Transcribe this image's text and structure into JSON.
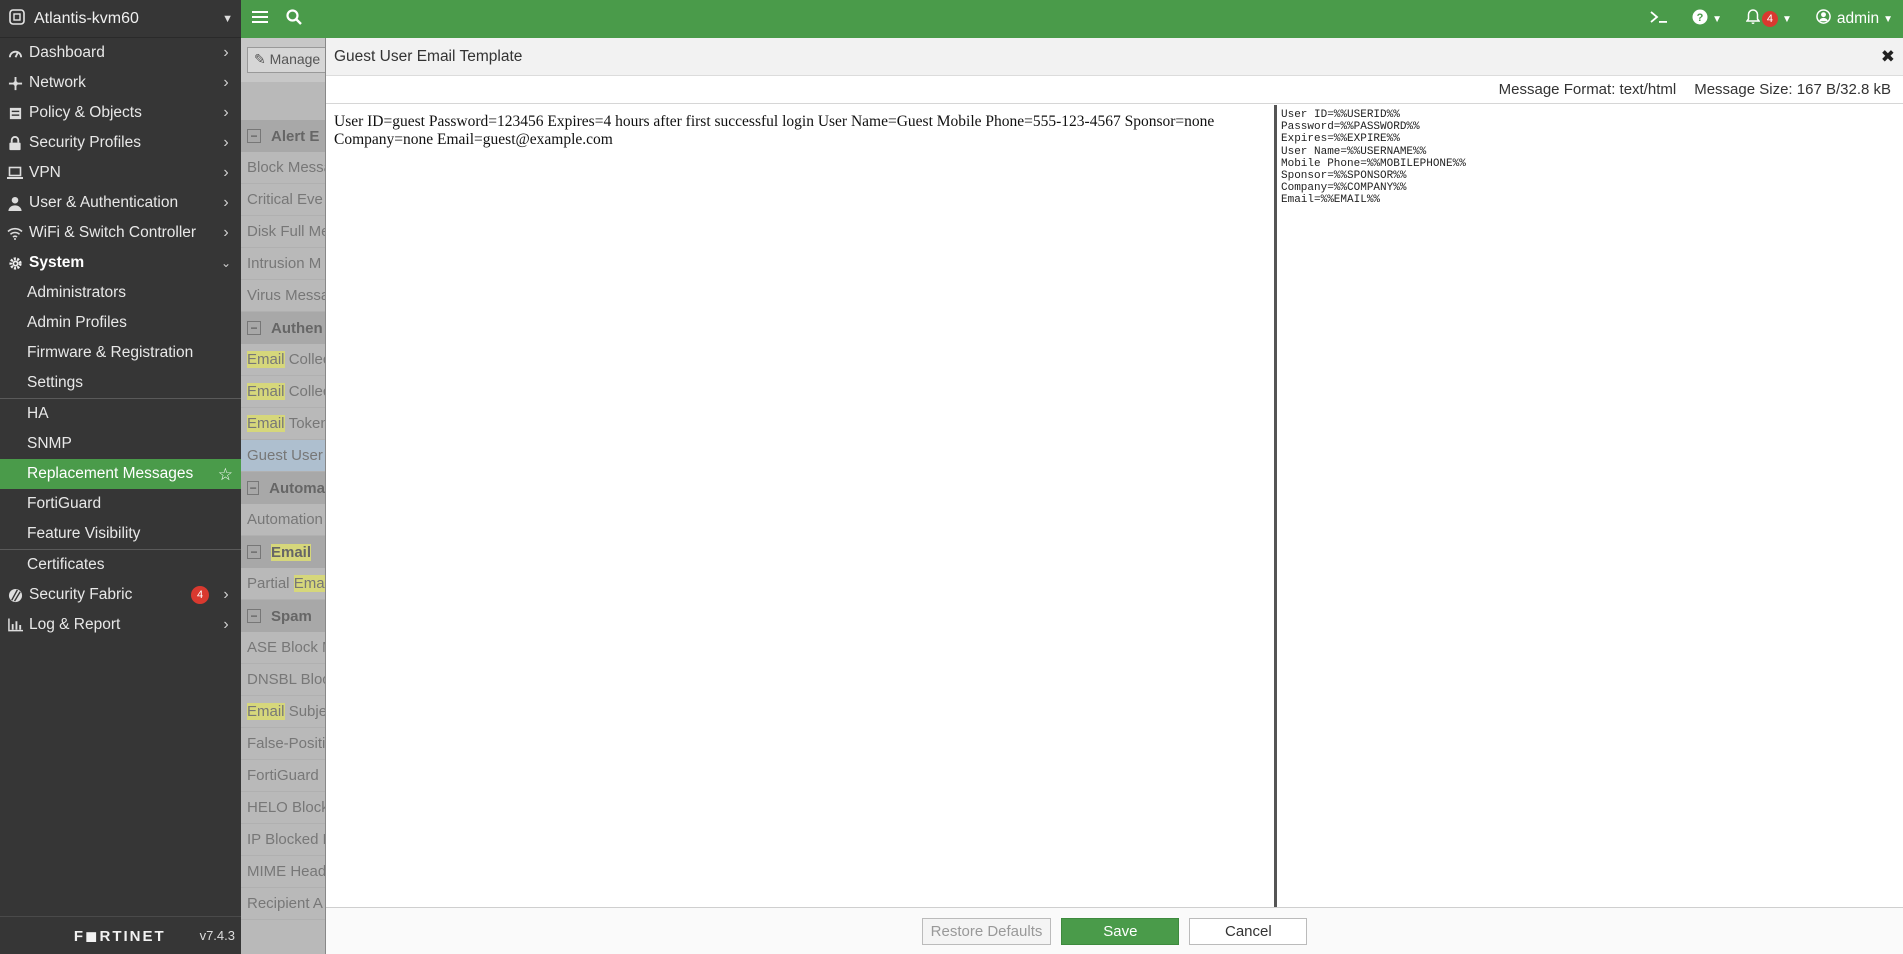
{
  "sidebar": {
    "hostname": "Atlantis-kvm60",
    "items": [
      {
        "label": "Dashboard",
        "icon": "dashboard-icon"
      },
      {
        "label": "Network",
        "icon": "network-icon"
      },
      {
        "label": "Policy & Objects",
        "icon": "policy-icon"
      },
      {
        "label": "Security Profiles",
        "icon": "lock-icon"
      },
      {
        "label": "VPN",
        "icon": "laptop-icon"
      },
      {
        "label": "User & Authentication",
        "icon": "user-icon"
      },
      {
        "label": "WiFi & Switch Controller",
        "icon": "wifi-icon"
      },
      {
        "label": "System",
        "icon": "gear-icon"
      }
    ],
    "system_sub": [
      "Administrators",
      "Admin Profiles",
      "Firmware & Registration",
      "Settings",
      "HA",
      "SNMP",
      "Replacement Messages",
      "FortiGuard",
      "Feature Visibility",
      "Certificates"
    ],
    "security_fabric": {
      "label": "Security Fabric",
      "badge": "4"
    },
    "log_report": {
      "label": "Log & Report"
    },
    "footer": {
      "logo": "F◼RTINET",
      "version": "v7.4.3"
    }
  },
  "topbar": {
    "notifications": "4",
    "user": "admin"
  },
  "background": {
    "manage_label": "Manage",
    "groups": [
      {
        "title": "Alert E",
        "rows": [
          "Block Messa",
          "Critical Eve",
          "Disk Full Me",
          "Intrusion M",
          "Virus Messa"
        ]
      },
      {
        "title": "Authen",
        "rows": [
          "Email Collec",
          "Email Collec",
          "Email Token",
          "Guest User"
        ]
      },
      {
        "title": "Automa",
        "rows": [
          "Automation"
        ]
      },
      {
        "title": "Email",
        "rows": [
          "Partial Email"
        ]
      },
      {
        "title": "Spam",
        "rows": [
          "ASE Block M",
          "DNSBL Bloc",
          "Email Subje",
          "False-Positi",
          "FortiGuard",
          "HELO Block",
          "IP Blocked M",
          "MIME Head",
          "Recipient A"
        ]
      }
    ]
  },
  "modal": {
    "title": "Guest User Email Template",
    "message_format": "Message Format: text/html",
    "message_size": "Message Size: 167 B/32.8 kB",
    "preview_text": "User ID=guest Password=123456 Expires=4 hours after first successful login User Name=Guest Mobile Phone=555-123-4567 Sponsor=none Company=none Email=guest@example.com",
    "source_text": "User ID=%%USERID%%\nPassword=%%PASSWORD%%\nExpires=%%EXPIRE%%\nUser Name=%%USERNAME%%\nMobile Phone=%%MOBILEPHONE%%\nSponsor=%%SPONSOR%%\nCompany=%%COMPANY%%\nEmail=%%EMAIL%%",
    "buttons": {
      "restore": "Restore Defaults",
      "save": "Save",
      "cancel": "Cancel"
    }
  }
}
